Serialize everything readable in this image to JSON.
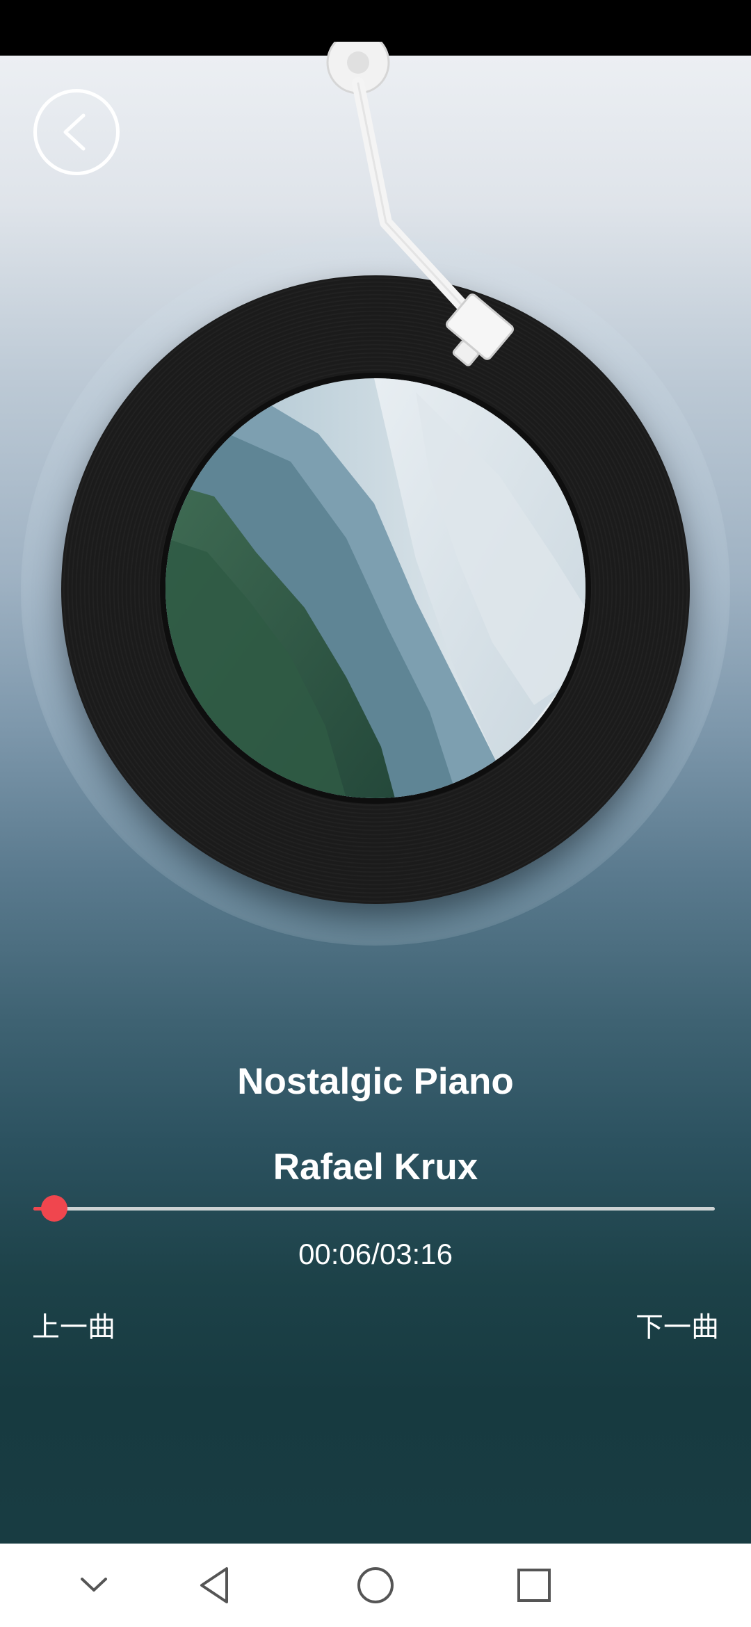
{
  "player": {
    "song_title": "Nostalgic Piano",
    "artist": "Rafael Krux",
    "time_display": "00:06/03:16",
    "progress_fraction": 0.0306,
    "prev_label": "上一曲",
    "next_label": "下一曲",
    "accent_color": "#f0464e"
  },
  "icons": {
    "back": "chevron-left-icon",
    "nav_collapse": "chevron-down-icon",
    "nav_back": "triangle-back-icon",
    "nav_home": "circle-home-icon",
    "nav_recents": "square-recents-icon"
  }
}
